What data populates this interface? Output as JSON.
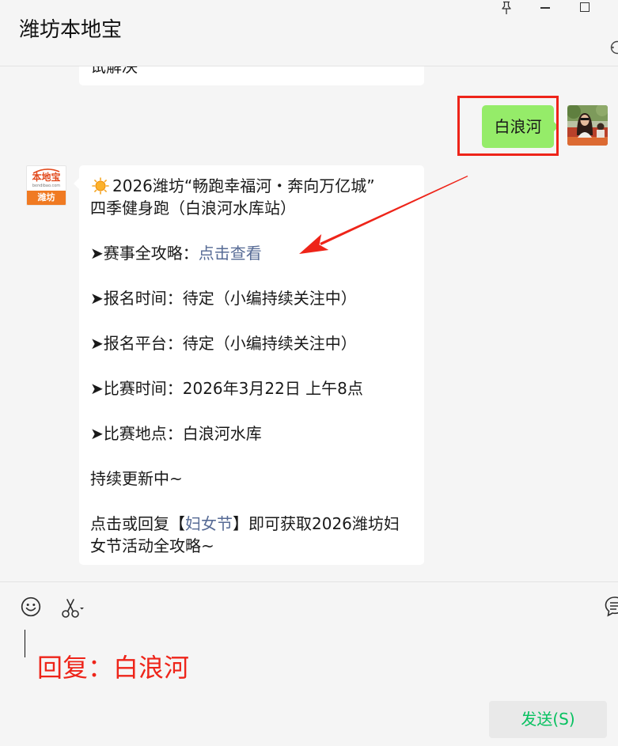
{
  "window": {
    "title": "潍坊本地宝",
    "controls": {
      "pin": "pin-icon",
      "minimize": "minimize-icon",
      "maximize": "maximize-icon",
      "more": "more-options-icon"
    }
  },
  "chat": {
    "previous_message_partial": "试解决",
    "sent_message": "白浪河",
    "received_message": {
      "sender_logo": {
        "brand": "本地宝",
        "domain": "bendibao.com",
        "city": "潍坊"
      },
      "emoji": "sun-emoji-icon",
      "title_line1": "2026潍坊“畅跑幸福河・奔向万亿城”",
      "title_line2": "四季健身跑（白浪河水库站）",
      "guide": {
        "label": "➤赛事全攻略：",
        "link": "点击查看"
      },
      "signup_time": "➤报名时间：待定（小编持续关注中）",
      "signup_platform": "➤报名平台：待定（小编持续关注中）",
      "race_time": "➤比赛时间：2026年3月22日 上午8点",
      "race_location": "➤比赛地点：白浪河水库",
      "updating": "持续更新中~",
      "cta": {
        "prefix": "点击或回复【",
        "keyword": "妇女节",
        "suffix": "】即可获取2026潍坊妇",
        "line2": "女节活动全攻略~"
      }
    }
  },
  "annotations": {
    "reply_hint": "回复：白浪河",
    "highlight_target": "sent-message",
    "arrow_target": "guide-link"
  },
  "composer": {
    "toolbar_icons": [
      "emoji-icon",
      "scissors-icon",
      "chat-history-icon"
    ],
    "input_value": "",
    "send_label": "发送(S)"
  },
  "colors": {
    "background": "#f5f5f5",
    "sent_bubble": "#95ec69",
    "received_bubble": "#ffffff",
    "link": "#576b95",
    "annotation_red": "#ee2419",
    "send_text": "#07c160",
    "send_button": "#e9e9e9",
    "logo_orange": "#f07a22"
  }
}
